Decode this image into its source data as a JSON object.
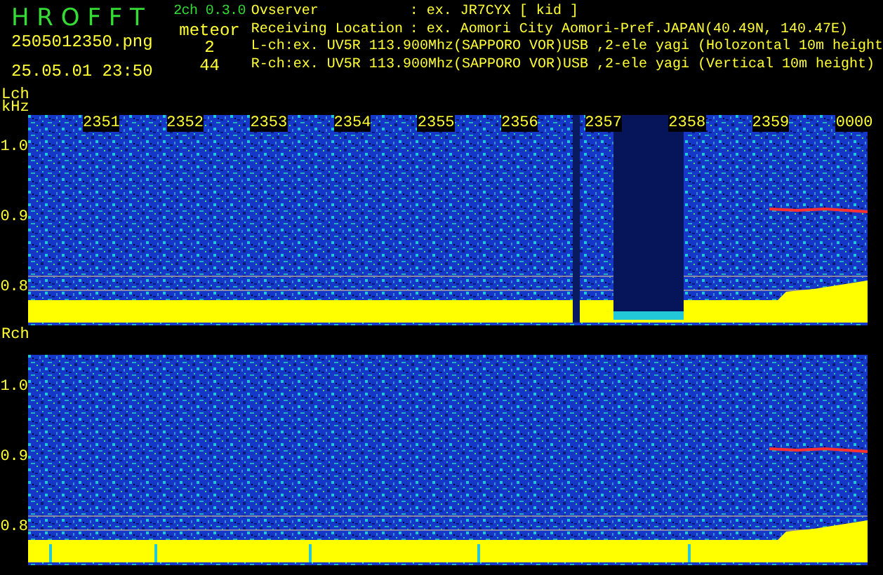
{
  "app": {
    "title": "H R O F F T",
    "version": "2ch 0.3.0",
    "filename": "2505012350.png",
    "datetime": "25.05.01 23:50",
    "count_label": "meteor",
    "counts": [
      "2",
      "44"
    ]
  },
  "info": [
    {
      "label": "Ovserver",
      "value": ": ex. JR7CYX [ kid ]"
    },
    {
      "label": "Receiving Location",
      "value": ": ex. Aomori City Aomori-Pref.JAPAN(40.49N, 140.47E)"
    },
    {
      "value": "L-ch:ex. UV5R 113.900Mhz(SAPPORO VOR)USB ,2-ele yagi (Holozontal 10m height"
    },
    {
      "value": "R-ch:ex. UV5R 113.900Mhz(SAPPORO VOR)USB ,2-ele yagi (Vertical 10m height)"
    }
  ],
  "panels": [
    {
      "channel": "Lch",
      "unit": "kHz",
      "time_labels": [
        "2351",
        "2352",
        "2353",
        "2354",
        "2355",
        "2356",
        "2357",
        "2358",
        "2359",
        "0000"
      ],
      "y_labels": [
        "1.0",
        "0.9",
        "0.8"
      ],
      "dropout": true,
      "meteor_echo": true
    },
    {
      "channel": "Rch",
      "y_labels": [
        "1.0",
        "0.9",
        "0.8"
      ],
      "dropout": false,
      "meteor_echo": true
    }
  ]
}
